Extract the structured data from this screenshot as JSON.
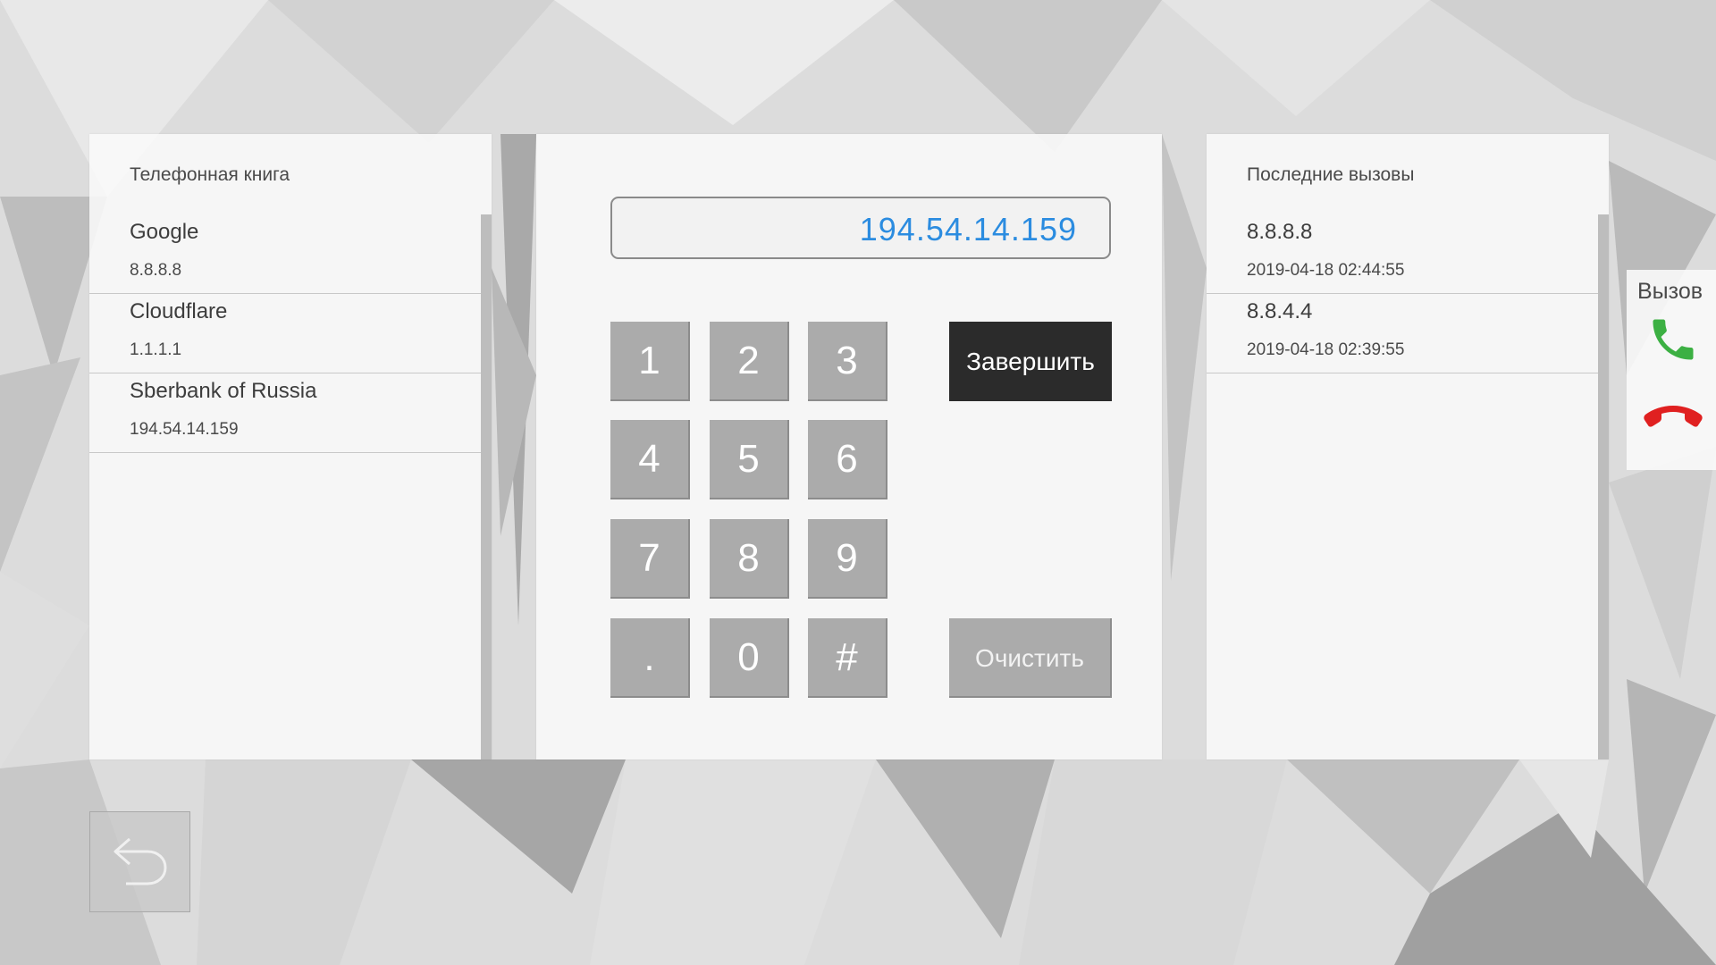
{
  "phonebook": {
    "title": "Телефонная книга",
    "entries": [
      {
        "name": "Google",
        "number": "8.8.8.8"
      },
      {
        "name": "Cloudflare",
        "number": "1.1.1.1"
      },
      {
        "name": "Sberbank of Russia",
        "number": "194.54.14.159"
      }
    ]
  },
  "dialer": {
    "display_value": "194.54.14.159",
    "keys": [
      "1",
      "2",
      "3",
      "4",
      "5",
      "6",
      "7",
      "8",
      "9",
      ".",
      "0",
      "#"
    ],
    "hangup_label": "Завершить",
    "clear_label": "Очистить"
  },
  "recent_calls": {
    "title": "Последние вызовы",
    "entries": [
      {
        "number": "8.8.8.8",
        "time": "2019-04-18 02:44:55"
      },
      {
        "number": "8.8.4.4",
        "time": "2019-04-18 02:39:55"
      }
    ]
  },
  "call_panel": {
    "label": "Вызов",
    "accept_icon": "phone-accept-icon",
    "reject_icon": "phone-hangup-icon",
    "accept_color": "#3cb043",
    "reject_color": "#e02020"
  },
  "back": {
    "icon": "back-arrow-icon"
  },
  "colors": {
    "accent": "#2b8ce0",
    "key": "#ababab",
    "hangup_bg": "#2b2b2b"
  }
}
